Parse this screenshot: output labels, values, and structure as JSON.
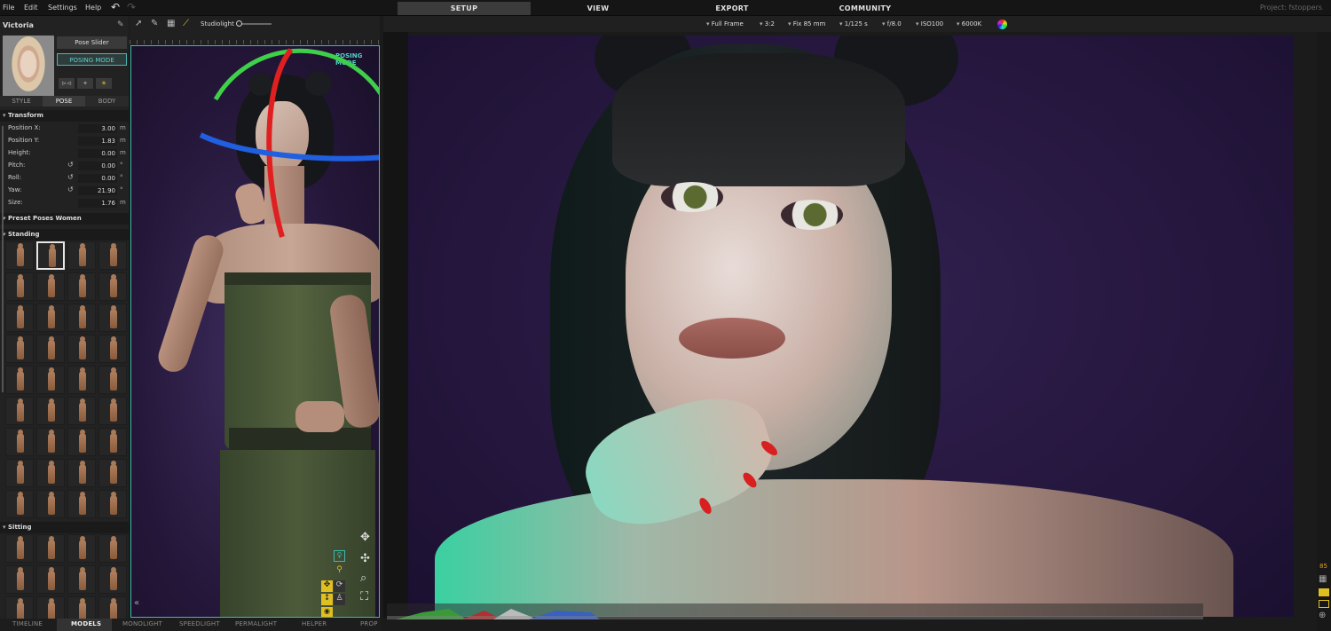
{
  "menu": {
    "items": [
      "File",
      "Edit",
      "Settings",
      "Help"
    ],
    "undo_icon": "undo-icon",
    "redo_icon": "redo-icon"
  },
  "topnav": [
    {
      "label": "SETUP",
      "active": true
    },
    {
      "label": "VIEW"
    },
    {
      "label": "EXPORT"
    },
    {
      "label": "COMMUNITY"
    }
  ],
  "project": "Project: fstoppers",
  "left_panel": {
    "model_name": "Victoria",
    "pose_slider_label": "Pose Slider",
    "posing_mode_label": "POSING MODE",
    "tabs": [
      "STYLE",
      "POSE",
      "BODY"
    ],
    "active_tab": "POSE",
    "transform": {
      "title": "Transform",
      "props": [
        {
          "label": "Position X:",
          "value": "3.00",
          "unit": "m"
        },
        {
          "label": "Position Y:",
          "value": "1.83",
          "unit": "m"
        },
        {
          "label": "Height:",
          "value": "0.00",
          "unit": "m"
        },
        {
          "label": "Pitch:",
          "value": "0.00",
          "unit": "°",
          "reset": true
        },
        {
          "label": "Roll:",
          "value": "0.00",
          "unit": "°",
          "reset": true
        },
        {
          "label": "Yaw:",
          "value": "21.90",
          "unit": "°",
          "reset": true
        },
        {
          "label": "Size:",
          "value": "1.76",
          "unit": "m"
        }
      ]
    },
    "preset_title": "Preset Poses Women",
    "standing_title": "Standing",
    "sitting_title": "Sitting"
  },
  "bottom_tabs": [
    "TIMELINE",
    "MODELS",
    "MONOLIGHT",
    "SPEEDLIGHT",
    "PERMALIGHT",
    "HELPER",
    "PROP"
  ],
  "active_bottom_tab": "MODELS",
  "viewport1": {
    "light_name": "Studiolight",
    "overlay": "POSING MODE"
  },
  "camera": {
    "frame": "Full Frame",
    "ratio": "3:2",
    "lens": "Fix 85 mm",
    "shutter": "1/125 s",
    "aperture": "f/8.0",
    "iso": "ISO100",
    "white_balance": "6000K"
  },
  "right_strip": {
    "number": "85"
  },
  "colors": {
    "accent": "#3fb8b0",
    "gizmo_red": "#e02020",
    "gizmo_green": "#3fd04a",
    "gizmo_blue": "#1f5fe0"
  }
}
